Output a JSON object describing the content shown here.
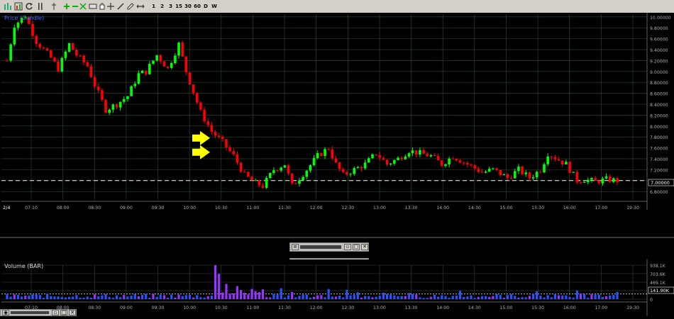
{
  "toolbar": {
    "timeframes": [
      "1",
      "2",
      "3",
      "15",
      "30",
      "60",
      "D",
      "W"
    ],
    "icons": [
      "chart-icon",
      "bar-chart-icon",
      "refresh-icon",
      "line-style-icon",
      "pan-icon",
      "zoom-in-icon",
      "zoom-out-icon",
      "zoom-reset-icon",
      "zoom-fit-icon",
      "crosshair-icon",
      "draw-line-icon",
      "draw-pencil-icon",
      "scroll-icon"
    ]
  },
  "price_panel": {
    "title": "Price (Candle)",
    "price_label": "7.00000"
  },
  "volume_panel": {
    "title": "Volume (BAR)",
    "volume_label": "141.90K"
  },
  "colors": {
    "up": "#00ff00",
    "down": "#ff0000",
    "grid": "#2e4d2e",
    "axis_text": "#b0b0b0",
    "arrow": "#ffff00",
    "vol_blue": "#2b52ff",
    "vol_purple": "#9933ff"
  },
  "chart_data": [
    {
      "type": "candlestick",
      "title": "Price (Candle)",
      "date_label": "2/4",
      "x_ticks": [
        "07:10",
        "08:00",
        "08:30",
        "09:00",
        "09:30",
        "10:00",
        "10:30",
        "11:00",
        "11:30",
        "12:00",
        "12:30",
        "13:00",
        "13:30",
        "14:00",
        "14:30",
        "15:00",
        "15:30",
        "16:00",
        "17:00",
        "19:30"
      ],
      "y_ticks": [
        "6.80000",
        "7.00000",
        "7.20000",
        "7.40000",
        "7.60000",
        "7.80000",
        "8.00000",
        "8.20000",
        "8.40000",
        "8.60000",
        "8.80000",
        "9.00000",
        "9.20000",
        "9.40000",
        "9.60000",
        "9.80000",
        "10.00000"
      ],
      "ylim": [
        6.75,
        10.05
      ],
      "reference_line": 7.0,
      "anchors": [
        [
          0,
          9.2
        ],
        [
          2,
          9.85
        ],
        [
          5,
          10.02
        ],
        [
          8,
          9.55
        ],
        [
          12,
          9.25
        ],
        [
          14,
          9.05
        ],
        [
          17,
          9.5
        ],
        [
          19,
          9.3
        ],
        [
          22,
          9.1
        ],
        [
          24,
          8.75
        ],
        [
          27,
          8.3
        ],
        [
          30,
          8.4
        ],
        [
          33,
          8.55
        ],
        [
          36,
          8.95
        ],
        [
          38,
          9.0
        ],
        [
          41,
          9.3
        ],
        [
          44,
          9.05
        ],
        [
          47,
          9.5
        ],
        [
          49,
          9.0
        ],
        [
          53,
          8.25
        ],
        [
          56,
          7.9
        ],
        [
          59,
          7.7
        ],
        [
          62,
          7.45
        ],
        [
          65,
          7.1
        ],
        [
          68,
          6.95
        ],
        [
          70,
          6.9
        ],
        [
          73,
          7.2
        ],
        [
          76,
          7.3
        ],
        [
          78,
          6.9
        ],
        [
          80,
          7.05
        ],
        [
          82,
          7.2
        ],
        [
          85,
          7.45
        ],
        [
          88,
          7.6
        ],
        [
          90,
          7.3
        ],
        [
          92,
          7.1
        ],
        [
          95,
          7.2
        ],
        [
          98,
          7.3
        ],
        [
          101,
          7.5
        ],
        [
          104,
          7.3
        ],
        [
          107,
          7.4
        ],
        [
          110,
          7.55
        ],
        [
          113,
          7.5
        ],
        [
          116,
          7.45
        ],
        [
          119,
          7.3
        ],
        [
          122,
          7.45
        ],
        [
          126,
          7.3
        ],
        [
          130,
          7.15
        ],
        [
          133,
          7.2
        ],
        [
          137,
          7.05
        ],
        [
          140,
          7.2
        ],
        [
          143,
          7.05
        ],
        [
          146,
          7.2
        ],
        [
          148,
          7.5
        ],
        [
          150,
          7.42
        ],
        [
          153,
          7.3
        ],
        [
          156,
          7.0
        ],
        [
          158,
          7.02
        ],
        [
          161,
          6.98
        ],
        [
          164,
          7.02
        ],
        [
          167,
          7.0
        ]
      ],
      "arrows_at_price": [
        7.78,
        7.52
      ]
    },
    {
      "type": "bar",
      "title": "Volume (BAR)",
      "x_ticks": [
        "07:10",
        "08:00",
        "08:30",
        "09:00",
        "09:30",
        "10:00",
        "10:30",
        "11:00",
        "11:30",
        "12:00",
        "12:30",
        "13:00",
        "13:30",
        "14:00",
        "14:30",
        "15:00",
        "15:30",
        "16:00",
        "17:00",
        "19:30"
      ],
      "y_ticks": [
        "938.1K",
        "703.6K",
        "469.1K",
        "234.5K",
        "0"
      ],
      "ylim": [
        0,
        938.1
      ],
      "reference_value": 141.9,
      "spikes": [
        [
          57,
          938
        ],
        [
          58,
          700
        ],
        [
          60,
          420
        ],
        [
          63,
          360
        ],
        [
          64,
          250
        ],
        [
          68,
          220
        ],
        [
          75,
          300
        ],
        [
          78,
          200
        ],
        [
          88,
          280
        ],
        [
          93,
          260
        ],
        [
          96,
          190
        ],
        [
          103,
          180
        ],
        [
          110,
          170
        ],
        [
          124,
          230
        ],
        [
          145,
          220
        ],
        [
          156,
          240
        ],
        [
          157,
          160
        ],
        [
          167,
          200
        ]
      ],
      "baseline_range": [
        30,
        150
      ]
    }
  ]
}
